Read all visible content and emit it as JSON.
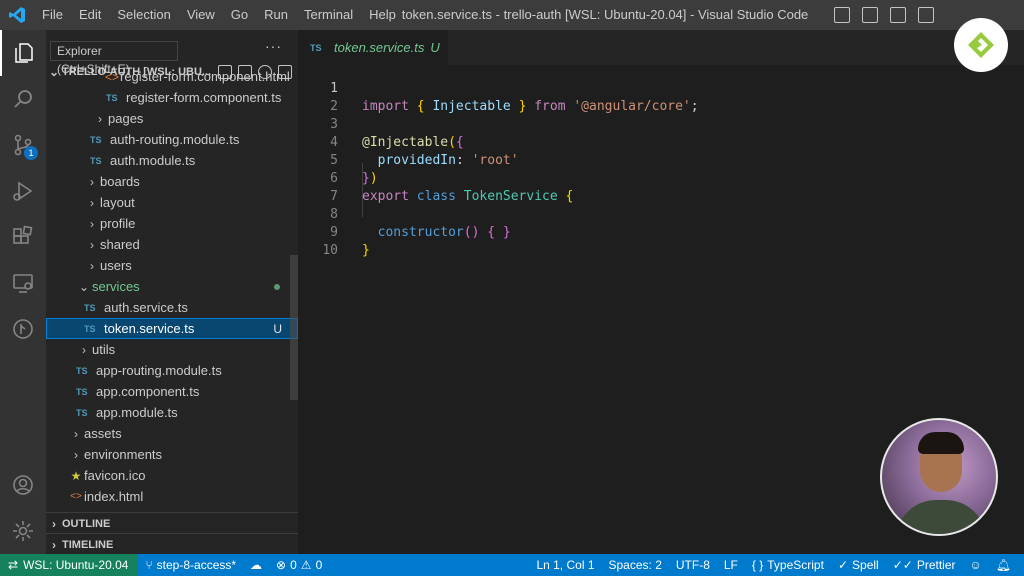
{
  "titlebar": {
    "menu": [
      "File",
      "Edit",
      "Selection",
      "View",
      "Go",
      "Run",
      "Terminal",
      "Help"
    ],
    "window_title": "token.service.ts - trello-auth [WSL: Ubuntu-20.04] - Visual Studio Code"
  },
  "activitybar": {
    "items": [
      "explorer-icon",
      "search-icon",
      "source-control-icon",
      "run-debug-icon",
      "extensions-icon",
      "remote-explorer-icon",
      "git-graph-icon",
      "account-icon",
      "settings-gear-icon"
    ],
    "scm_badge": "1"
  },
  "tooltip": "Explorer (Ctrl+Shift+E)",
  "sidebar": {
    "project_title": "TRELLO-AUTH [WSL: UBU...",
    "tree": [
      {
        "label": "register-form.component.html",
        "type": "html",
        "depth": 4
      },
      {
        "label": "register-form.component.ts",
        "type": "ts",
        "depth": 4
      },
      {
        "label": "pages",
        "type": "folder",
        "depth": 3
      },
      {
        "label": "auth-routing.module.ts",
        "type": "ts",
        "depth": 3
      },
      {
        "label": "auth.module.ts",
        "type": "ts",
        "depth": 3
      },
      {
        "label": "boards",
        "type": "folder",
        "depth": 2
      },
      {
        "label": "layout",
        "type": "folder",
        "depth": 2
      },
      {
        "label": "profile",
        "type": "folder",
        "depth": 2
      },
      {
        "label": "shared",
        "type": "folder",
        "depth": 2
      },
      {
        "label": "users",
        "type": "folder",
        "depth": 2
      },
      {
        "label": "services",
        "type": "folder-open",
        "depth": 1
      },
      {
        "label": "auth.service.ts",
        "type": "ts",
        "depth": 2
      },
      {
        "label": "token.service.ts",
        "type": "ts",
        "depth": 2
      },
      {
        "label": "utils",
        "type": "folder",
        "depth": 1
      },
      {
        "label": "app-routing.module.ts",
        "type": "ts",
        "depth": 1
      },
      {
        "label": "app.component.ts",
        "type": "ts",
        "depth": 1
      },
      {
        "label": "app.module.ts",
        "type": "ts",
        "depth": 1
      },
      {
        "label": "assets",
        "type": "folder",
        "depth": 0
      },
      {
        "label": "environments",
        "type": "folder",
        "depth": 0
      },
      {
        "label": "favicon.ico",
        "type": "ico",
        "depth": 0
      },
      {
        "label": "index.html",
        "type": "html",
        "depth": 0
      }
    ],
    "selected_status": "U",
    "outline_label": "OUTLINE",
    "timeline_label": "TIMELINE"
  },
  "tab": {
    "lang": "TS",
    "filename": "token.service.ts",
    "status": "U"
  },
  "file_lang_badge": "TS",
  "editor": {
    "line_numbers": [
      "1",
      "2",
      "3",
      "4",
      "5",
      "6",
      "7",
      "8",
      "9",
      "10"
    ],
    "l1": {
      "import": "import",
      "open": "{",
      "name": "Injectable",
      "close": "}",
      "from": "from",
      "module": "'@angular/core'",
      "semi": ";"
    },
    "l3": {
      "decorator": "@Injectable",
      "paren": "(",
      "brace": "{"
    },
    "l4": {
      "key": "providedIn",
      "colon": ":",
      "value": "'root'"
    },
    "l5": {
      "brace": "}",
      "paren": ")"
    },
    "l6": {
      "export": "export",
      "class": "class",
      "name": "TokenService",
      "brace": "{"
    },
    "l8": {
      "ctor": "constructor",
      "parens": "()",
      "open": "{",
      "close": "}"
    },
    "l9": {
      "brace": "}"
    }
  },
  "statusbar": {
    "remote": "WSL: Ubuntu-20.04",
    "branch": "step-8-access*",
    "problems": "0",
    "warnings": "0",
    "cursor": "Ln 1, Col 1",
    "spaces": "Spaces: 2",
    "encoding": "UTF-8",
    "eol": "LF",
    "language": "TypeScript",
    "spell": "Spell",
    "prettier": "Prettier"
  },
  "colors": {
    "accent": "#007acc",
    "remote": "#16825d",
    "untracked": "#73c991",
    "selection": "#094771"
  }
}
